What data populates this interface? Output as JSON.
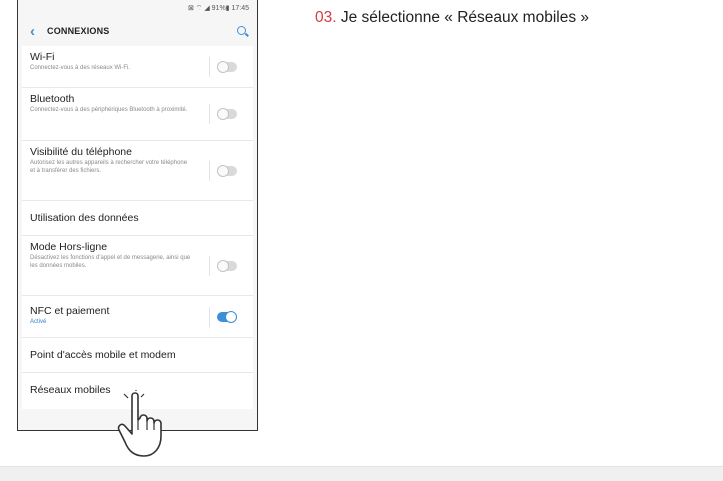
{
  "status_bar": {
    "text": "⊠ ⌔ ◢ 91%▮ 17:45"
  },
  "app_bar": {
    "back_icon": "chevron-left-icon",
    "title": "CONNEXIONS",
    "search_icon": "search-icon"
  },
  "items": [
    {
      "title": "Wi-Fi",
      "subtitle": "Connectez-vous à des réseaux Wi-Fi.",
      "toggle": "off"
    },
    {
      "title": "Bluetooth",
      "subtitle": "Connectez-vous à des périphériques Bluetooth à proximité.",
      "toggle": "off"
    },
    {
      "title": "Visibilité du téléphone",
      "subtitle": "Autorisez les autres appareils à rechercher votre téléphone et à transférer des fichiers.",
      "toggle": "off"
    },
    {
      "title": "Utilisation des données"
    },
    {
      "title": "Mode Hors-ligne",
      "subtitle": "Désactivez les fonctions d'appel et de messagerie, ainsi que les données mobiles.",
      "toggle": "off"
    },
    {
      "title": "NFC et paiement",
      "subtitle": "Activé",
      "toggle": "on"
    },
    {
      "title": "Point d'accès mobile et modem"
    },
    {
      "title": "Réseaux mobiles"
    }
  ],
  "caption": {
    "number": "03.",
    "text": " Je sélectionne « Réseaux mobiles »"
  },
  "colors": {
    "accent": "#3d8fd9",
    "caption_number": "#d93b3b"
  }
}
